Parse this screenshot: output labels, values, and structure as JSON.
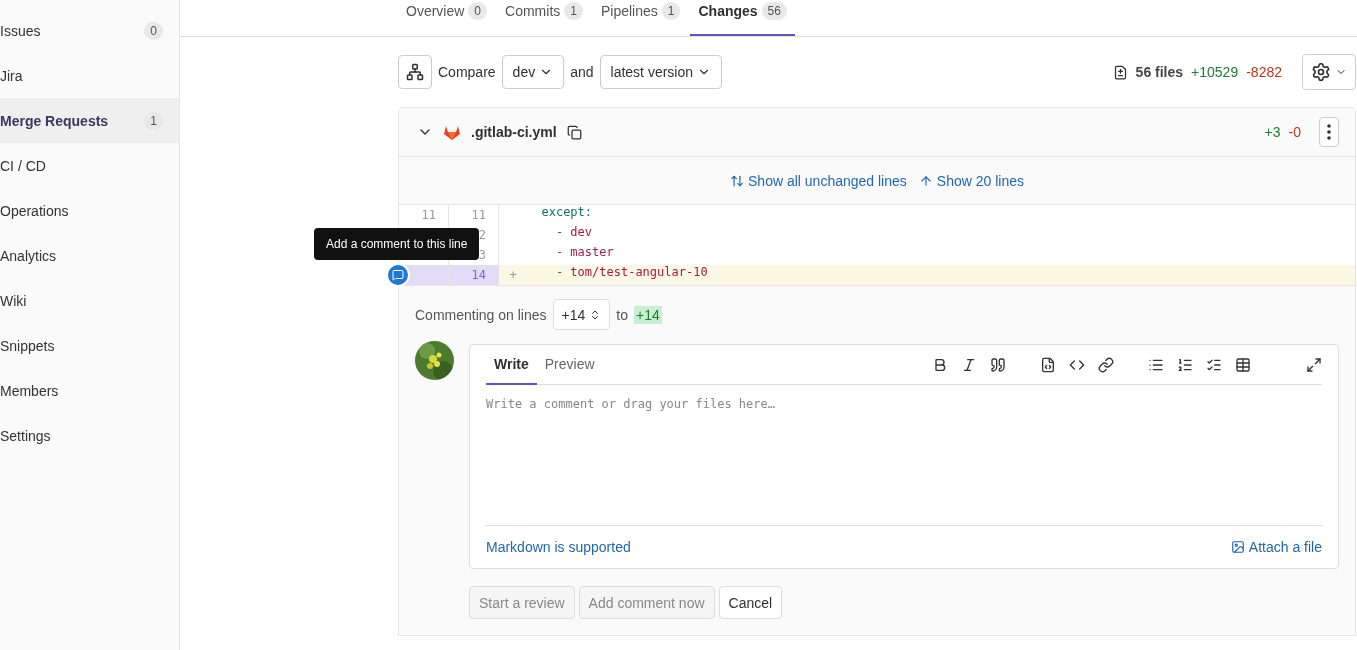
{
  "sidebar": {
    "items": [
      {
        "label": "Issues",
        "count": "0",
        "selected": false
      },
      {
        "label": "Jira",
        "selected": false
      },
      {
        "label": "Merge Requests",
        "count": "1",
        "selected": true
      },
      {
        "label": "CI / CD",
        "selected": false
      },
      {
        "label": "Operations",
        "selected": false
      },
      {
        "label": "Analytics",
        "selected": false
      },
      {
        "label": "Wiki",
        "selected": false
      },
      {
        "label": "Snippets",
        "selected": false
      },
      {
        "label": "Members",
        "selected": false
      },
      {
        "label": "Settings",
        "selected": false
      }
    ]
  },
  "tabs": [
    {
      "label": "Overview",
      "count": "0",
      "selected": false
    },
    {
      "label": "Commits",
      "count": "1",
      "selected": false
    },
    {
      "label": "Pipelines",
      "count": "1",
      "selected": false
    },
    {
      "label": "Changes",
      "count": "56",
      "selected": true
    }
  ],
  "compare": {
    "label": "Compare",
    "from": "dev",
    "and": "and",
    "to": "latest version"
  },
  "stats": {
    "files": "56 files",
    "added": "+10529",
    "removed": "-8282"
  },
  "file": {
    "name": ".gitlab-ci.yml",
    "added": "+3",
    "removed": "-0",
    "expand_links": [
      "Show all unchanged lines",
      "Show 20 lines"
    ],
    "lines": [
      {
        "old": "11",
        "new": "11",
        "kind": "context",
        "code": "  except:",
        "selected": false
      },
      {
        "new": "2",
        "kind": "context",
        "code": "    - dev",
        "selected": false
      },
      {
        "new": "3",
        "kind": "context",
        "code": "    - master",
        "selected": false
      },
      {
        "new": "14",
        "kind": "added",
        "marker": "+",
        "code": "    - tom/test-angular-10",
        "selected": true
      }
    ]
  },
  "tooltip": "Add a comment to this line",
  "comment_form": {
    "range_label": "Commenting on lines",
    "range_start": "+14",
    "to": "to",
    "range_end": "+14",
    "tabs": [
      {
        "label": "Write",
        "selected": true
      },
      {
        "label": "Preview",
        "selected": false
      }
    ],
    "placeholder": "Write a comment or drag your files here…",
    "markdown_link": "Markdown is supported",
    "attach": "Attach a file",
    "buttons": [
      {
        "label": "Start a review",
        "disabled": true
      },
      {
        "label": "Add comment now",
        "disabled": true
      },
      {
        "label": "Cancel",
        "disabled": false
      }
    ]
  }
}
